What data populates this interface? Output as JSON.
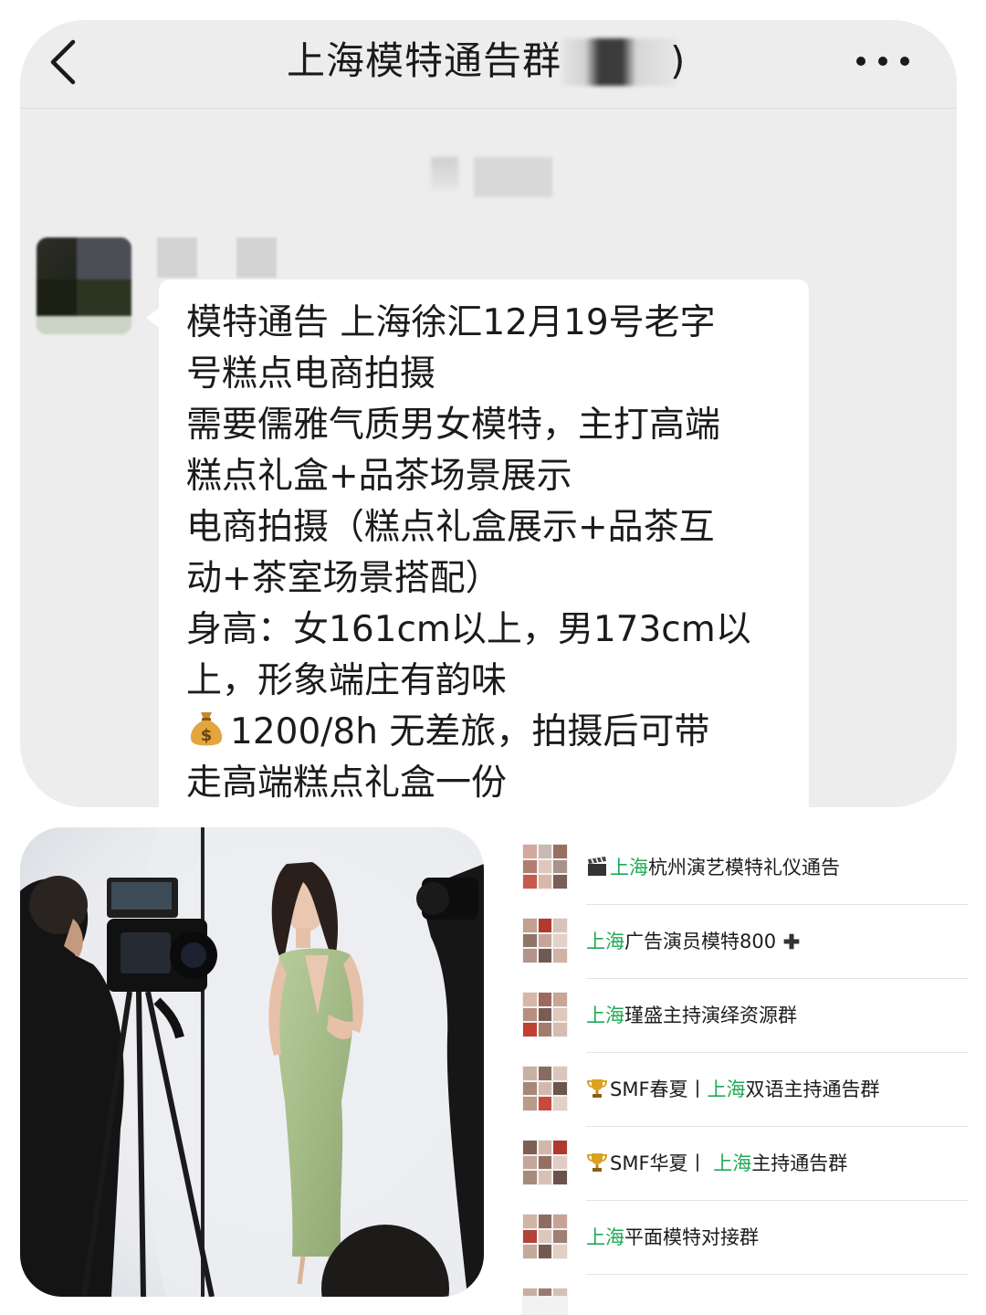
{
  "header": {
    "title": "上海模特通告群",
    "title_suffix": ")"
  },
  "message": {
    "lines": [
      "模特通告 上海徐汇12月19号老字",
      "号糕点电商拍摄",
      "需要儒雅气质男女模特，主打高端",
      "糕点礼盒+品茶场景展示",
      "电商拍摄（糕点礼盒展示+品茶互",
      "动+茶室场景搭配）",
      "身高：女161cm以上，男173cm以",
      "上，形象端庄有韵味",
      "1200/8h 无差旅，拍摄后可带",
      "走高端糕点礼盒一份"
    ],
    "pay_icon": "money-bag-icon"
  },
  "groups": [
    {
      "icon": "clapperboard-icon",
      "highlight": "上海",
      "prefix": "",
      "rest": "杭州演艺模特礼仪通告"
    },
    {
      "icon": "",
      "highlight": "上海",
      "prefix": "",
      "rest": "广告演员模特800",
      "suffix_icon": "plus-icon"
    },
    {
      "icon": "",
      "highlight": "上海",
      "prefix": "",
      "rest": "瑾盛主持演绎资源群"
    },
    {
      "icon": "trophy-icon",
      "prefix": "SMF春夏丨",
      "highlight": "上海",
      "rest": "双语主持通告群"
    },
    {
      "icon": "trophy-icon",
      "prefix": "SMF华夏丨 ",
      "highlight": "上海",
      "rest": "主持通告群"
    },
    {
      "icon": "",
      "highlight": "上海",
      "prefix": "",
      "rest": "平面模特对接群"
    }
  ],
  "colors": {
    "chat_background": "#ededed",
    "bubble": "#ffffff",
    "highlight_green": "#1eaa55",
    "dress_green": "#a9bf8a"
  }
}
